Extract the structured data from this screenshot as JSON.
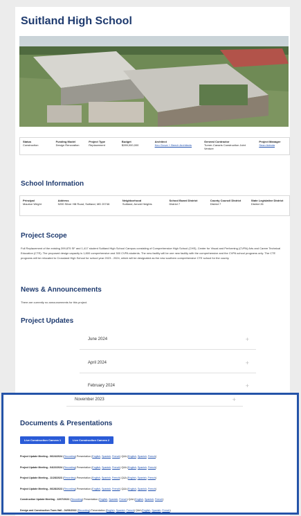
{
  "page": {
    "title": "Suitland High School"
  },
  "status_bar": [
    {
      "label": "Status",
      "value": "Construction"
    },
    {
      "label": "Funding Model",
      "value": "Design Renovation"
    },
    {
      "label": "Project Type",
      "value": "Replacement"
    },
    {
      "label": "Budget",
      "value": "$289,000,000"
    },
    {
      "label": "Architect",
      "value": "Keo Grove + Beech Architects",
      "link": true
    },
    {
      "label": "General Contractor",
      "value": "Turner-Canaris Construction Joint Venture"
    },
    {
      "label": "Project Manager",
      "value": "Sean Adeola",
      "link": true
    }
  ],
  "school_info": {
    "heading": "School Information",
    "cells": [
      {
        "label": "Principal",
        "value": "Maurice Wright"
      },
      {
        "label": "Address",
        "value": "5200 Silver Hill Road, Suitland, MD 20746"
      },
      {
        "label": "Neighborhood",
        "value": "Suitland, Arnold Heights"
      },
      {
        "label": "School Board District",
        "value": "District 7"
      },
      {
        "label": "County Council District",
        "value": "District 7"
      },
      {
        "label": "State Legislative District",
        "value": "District 26"
      }
    ]
  },
  "scope": {
    "heading": "Project Scope",
    "text": "Full Replacement of the existing 399,875 SF and 1,417 student Suitland High School Campus consisting of Comprehensive High School (CHS), Center for Visual and Performing (CVPA) Arts and Career Technical Education (CTE). The proposed design capacity is 1,800 comprehensive and 300 CVPA students. The new facility will be one new facility with the comprehensive and the CVPA school programs only. The CTE programs will be relocated to Crossland High School for school year 2023 - 2024, which will be designated as the new southern comprehensive CTE school for the county."
  },
  "news": {
    "heading": "News & Announcements",
    "text": "There are currently no announcements for this project."
  },
  "updates": {
    "heading": "Project Updates",
    "items": [
      "June 2024",
      "April 2024",
      "February 2024",
      "November 2023"
    ]
  },
  "documents": {
    "heading": "Documents & Presentations",
    "buttons": [
      "Live Construction Camera 1",
      "Live Construction Camera 2"
    ],
    "rows": [
      {
        "title": "Project Update Meeting - 06/24/2024",
        "parts": [
          "Recording",
          "Presentation",
          "English",
          "Spanish",
          "French",
          "Q&A",
          "English",
          "Spanish",
          "French"
        ]
      },
      {
        "title": "Project Update Meeting - 04/22/2024",
        "parts": [
          "Recording",
          "Presentation",
          "English",
          "Spanish",
          "French",
          "Q&A",
          "English",
          "Spanish",
          "French"
        ]
      },
      {
        "title": "Project Update Meeting - 11/28/2023",
        "parts": [
          "Recording",
          "Presentation",
          "English",
          "Spanish",
          "French",
          "Q&A",
          "English",
          "Spanish",
          "French"
        ]
      },
      {
        "title": "Project Update Meeting - 06/28/2023",
        "parts": [
          "Recording",
          "Presentation",
          "English",
          "Spanish",
          "French",
          "Q&A",
          "English",
          "Spanish",
          "French"
        ]
      },
      {
        "title": "Construction Update Meeting - 12/07/2022",
        "parts": [
          "Recording",
          "Presentation",
          "English",
          "Spanish",
          "French",
          "Q&A",
          "English",
          "Spanish",
          "French"
        ]
      },
      {
        "title": "Design and Construction Town Hall - 04/06/2022",
        "parts": [
          "Recording",
          "Presentation",
          "English",
          "Spanish",
          "French",
          "Q&A",
          "English",
          "Spanish",
          "French"
        ]
      }
    ]
  }
}
